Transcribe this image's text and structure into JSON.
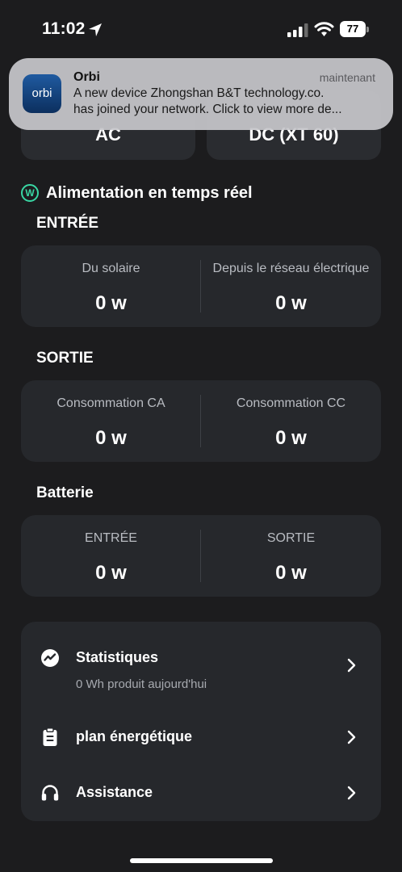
{
  "status_bar": {
    "time": "11:02",
    "battery_level": "77",
    "icons": [
      "location-arrow-icon",
      "cellular-signal-icon",
      "wifi-icon",
      "battery-icon"
    ]
  },
  "notification": {
    "app_name": "Orbi",
    "app_icon_text": "orbi",
    "time": "maintenant",
    "line1": "A new device Zhongshan B&T technology.co.",
    "line2": "has joined your network. Click to view more de..."
  },
  "top_cards": {
    "left_label": "AC",
    "right_label": "DC (XT 60)"
  },
  "realtime": {
    "icon_letter": "W",
    "title": "Alimentation en temps réel"
  },
  "input": {
    "title": "ENTRÉE",
    "left_label": "Du solaire",
    "left_value": "0 w",
    "right_label": "Depuis le réseau électrique",
    "right_value": "0 w"
  },
  "output": {
    "title": "SORTIE",
    "left_label": "Consommation CA",
    "left_value": "0 w",
    "right_label": "Consommation CC",
    "right_value": "0 w"
  },
  "battery_section": {
    "title": "Batterie",
    "left_label": "ENTRÉE",
    "left_value": "0 w",
    "right_label": "SORTIE",
    "right_value": "0 w"
  },
  "menu": {
    "statistics_label": "Statistiques",
    "statistics_sub": "0 Wh produit aujourd'hui",
    "plan_label": "plan énergétique",
    "support_label": "Assistance"
  },
  "colors": {
    "background": "#1c1c1e",
    "card": "#26282c",
    "accent_green": "#39d7a4"
  }
}
